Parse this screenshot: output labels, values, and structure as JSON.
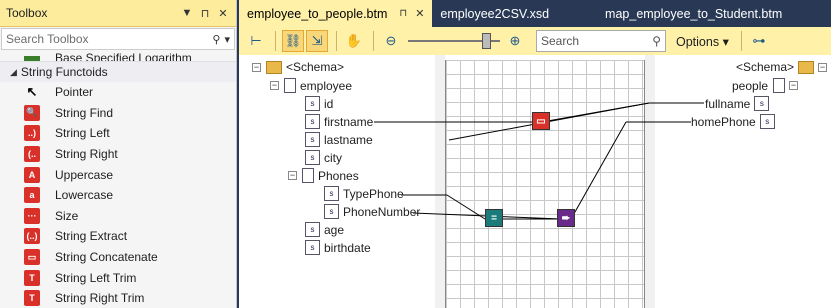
{
  "toolbox": {
    "title": "Toolbox",
    "pin_glyph": "▼ ⊓ ✕",
    "search_placeholder": "Search Toolbox",
    "cut_item": "Base Specified Logarithm",
    "group": "String Functoids",
    "items": [
      {
        "label": "Pointer",
        "icon": "pointer-icon"
      },
      {
        "label": "String Find",
        "icon": "string-find-icon"
      },
      {
        "label": "String Left",
        "icon": "string-left-icon"
      },
      {
        "label": "String Right",
        "icon": "string-right-icon"
      },
      {
        "label": "Uppercase",
        "icon": "uppercase-icon"
      },
      {
        "label": "Lowercase",
        "icon": "lowercase-icon"
      },
      {
        "label": "Size",
        "icon": "size-icon"
      },
      {
        "label": "String Extract",
        "icon": "string-extract-icon"
      },
      {
        "label": "String Concatenate",
        "icon": "string-concatenate-icon"
      },
      {
        "label": "String Left Trim",
        "icon": "string-left-trim-icon"
      },
      {
        "label": "String Right Trim",
        "icon": "string-right-trim-icon"
      }
    ]
  },
  "tabs": [
    {
      "label": "employee_to_people.btm",
      "active": true
    },
    {
      "label": "employee2CSV.xsd",
      "active": false
    },
    {
      "label": "map_employee_to_Student.btm",
      "active": false
    }
  ],
  "toolbar": {
    "search_placeholder": "Search",
    "options_label": "Options",
    "zoom_level": 0.85
  },
  "source_schema": {
    "root": "<Schema>",
    "record": "employee",
    "fields": [
      "id",
      "firstname",
      "lastname",
      "city"
    ],
    "group": "Phones",
    "group_fields": [
      "TypePhone",
      "PhoneNumber"
    ],
    "more_fields": [
      "age",
      "birthdate"
    ]
  },
  "dest_schema": {
    "root": "<Schema>",
    "record": "people",
    "fields": [
      "fullname",
      "homePhone"
    ]
  },
  "colors": {
    "toolbox_title_bg": "#fcec9c",
    "active_tab_bg": "#fff1a8",
    "frame_bg": "#293955",
    "concat_functoid": "#d9302a",
    "equal_functoid": "#1b7b7b",
    "value_mapping_functoid": "#6a2a8a"
  }
}
